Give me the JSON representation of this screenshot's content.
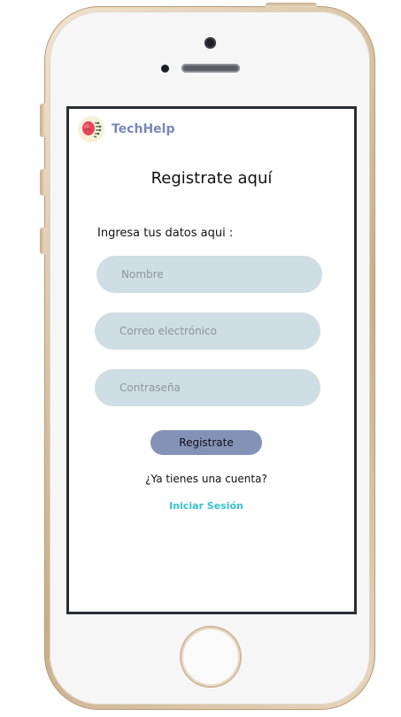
{
  "app": {
    "brand": "TechHelp",
    "accent_color": "#7a88b4",
    "link_color": "#36c3cf"
  },
  "register": {
    "title": "Registrate aquí",
    "subtitle": "Ingresa tus datos aqui :",
    "name_placeholder": "Nombre",
    "email_placeholder": "Correo electrónico",
    "password_placeholder": "Contraseña",
    "submit_label": "Registrate",
    "have_account_text": "¿Ya tienes una cuenta?",
    "login_label": "Iniciar Sesión"
  },
  "icons": {
    "logo": "brain-logo-icon"
  }
}
